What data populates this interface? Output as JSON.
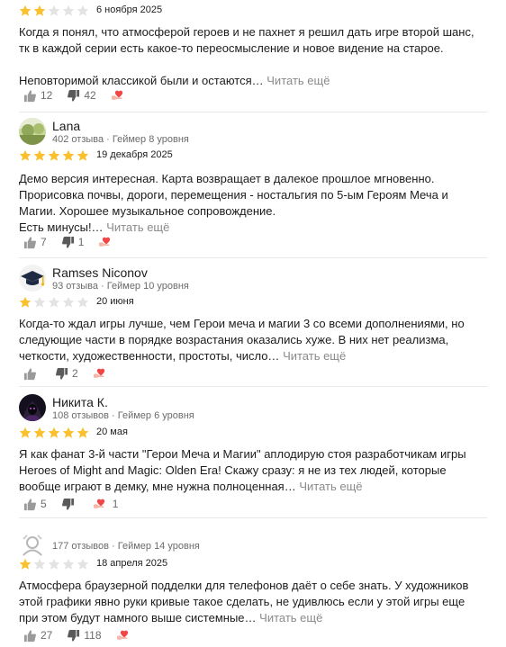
{
  "reviews": [
    {
      "user": null,
      "rating": 2,
      "date": "6 ноября 2025",
      "paragraphs": [
        "Когда я понял, что атмосферой героев и не пахнет я решил дать игре второй шанс, тк в каждой серии есть какое-то переосмысление и новое видение на старое.",
        "Неповторимой классикой были и остаются…"
      ],
      "read_more": "Читать ещё",
      "likes": "12",
      "dislikes": "42",
      "reactions": ""
    },
    {
      "user": {
        "name": "Lana",
        "meta": "402 отзыва · Геймер 8 уровня",
        "avatar": "landscape-avatar"
      },
      "rating": 5,
      "date": "19 декабря 2025",
      "paragraphs": [
        "Демо версия интересная. Карта возвращает в далекое прошлое мгновенно. Прорисовка почвы, дороги, перемещения - ностальгия по 5-ым Героям Меча и Магии. Хорошее музыкальное сопровождение.",
        "Есть минусы!…"
      ],
      "read_more": "Читать ещё",
      "likes": "7",
      "dislikes": "1",
      "reactions": ""
    },
    {
      "user": {
        "name": "Ramses Niconov",
        "meta": "93 отзыва · Геймер 10 уровня",
        "avatar": "graduation-cap-avatar"
      },
      "rating": 1,
      "date": "20 июня",
      "paragraphs": [
        "Когда-то ждал игры лучше, чем Герои меча и магии 3 со всеми дополнениями, но следующие части в порядке возрастания оказались хуже. В них нет реализма, четкости, художественности, простоты, число…"
      ],
      "read_more": "Читать ещё",
      "likes": "",
      "dislikes": "2",
      "reactions": ""
    },
    {
      "user": {
        "name": "Никита К.",
        "meta": "108 отзывов · Геймер 6 уровня",
        "avatar": "dark-hooded-avatar"
      },
      "rating": 5,
      "date": "20 мая",
      "paragraphs": [
        "Я как фанат 3-й части \"Герои Меча и Магии\" аплодирую стоя разработчикам игры Heroes of Might and Magic: Olden Era! Скажу сразу: я не из тех людей, которые вообще играют в демку, мне нужна полноценная…"
      ],
      "read_more": "Читать ещё",
      "likes": "5",
      "dislikes": "",
      "reactions": "1"
    },
    {
      "user": {
        "name": "",
        "meta": "177 отзывов · Геймер 14 уровня",
        "avatar": "default-user-avatar"
      },
      "rating": 1,
      "date": "18 апреля 2025",
      "paragraphs": [
        "Атмосфера браузерной подделки для телефонов даёт о себе знать. У художников этой графики явно руки кривые такое сделать, не удивлюсь если у этой игры еще при этом будут намного выше системные…"
      ],
      "read_more": "Читать ещё",
      "likes": "27",
      "dislikes": "118",
      "reactions": ""
    }
  ],
  "colors": {
    "star_on": "#fbc02d",
    "star_off": "#e3e3e3",
    "muted": "#8a8a8a",
    "text": "#1c1c1c",
    "reaction_red": "#ef4747"
  }
}
